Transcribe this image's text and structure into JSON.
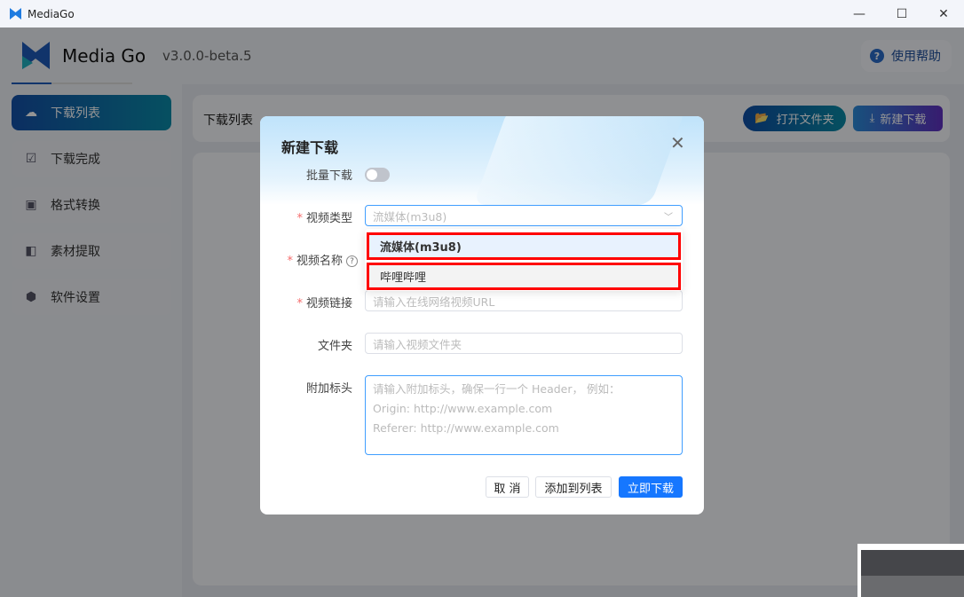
{
  "window": {
    "title": "MediaGo",
    "minimize": "—",
    "maximize": "☐",
    "close": "✕"
  },
  "brand": {
    "name": "Media Go",
    "version": "v3.0.0-beta.5"
  },
  "help": {
    "label": "使用帮助",
    "icon": "?"
  },
  "sidebar": {
    "items": [
      {
        "label": "下载列表",
        "icon": "cloud-download-icon",
        "active": true
      },
      {
        "label": "下载完成",
        "icon": "check-box-icon"
      },
      {
        "label": "格式转换",
        "icon": "convert-icon"
      },
      {
        "label": "素材提取",
        "icon": "extract-icon"
      },
      {
        "label": "软件设置",
        "icon": "settings-icon"
      }
    ]
  },
  "header": {
    "title": "下载列表",
    "open_folder": "打开文件夹",
    "new_download": "新建下载"
  },
  "colors": {
    "primary": "#1677ff",
    "required": "#f56c6c",
    "highlight": "#ff0000"
  },
  "modal": {
    "title": "新建下载",
    "close": "✕",
    "batch_label": "批量下载",
    "batch_on": false,
    "type_label": "视频类型",
    "type_value": "流媒体(m3u8)",
    "type_options": [
      "流媒体(m3u8)",
      "哔哩哔哩"
    ],
    "name_label": "视频名称",
    "link_label": "视频链接",
    "link_placeholder": "请输入在线网络视频URL",
    "folder_label": "文件夹",
    "folder_placeholder": "请输入视频文件夹",
    "headers_label": "附加标头",
    "headers_placeholder": [
      "请输入附加标头，确保一行一个 Header， 例如：",
      "Origin: http://www.example.com",
      "Referer: http://www.example.com"
    ],
    "required_mark": "*",
    "cancel": "取 消",
    "add_to_list": "添加到列表",
    "download_now": "立即下载"
  }
}
